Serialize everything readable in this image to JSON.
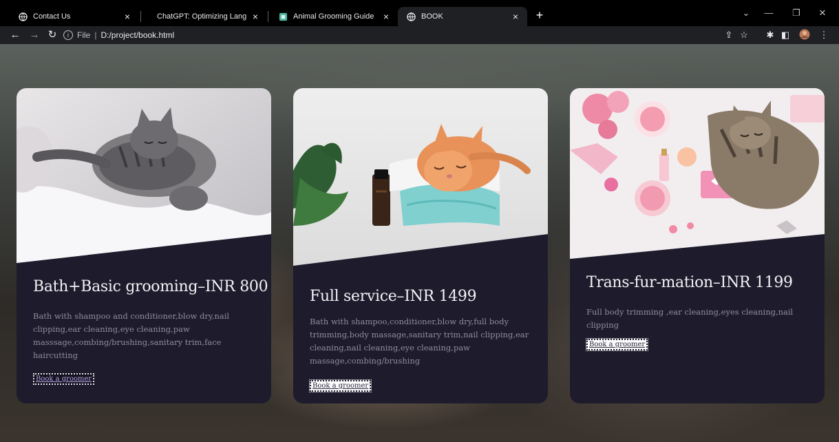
{
  "browser": {
    "tabs": [
      {
        "title": "Contact Us",
        "icon": "globe-icon",
        "active": false
      },
      {
        "title": "ChatGPT: Optimizing Language M",
        "icon": "chatgpt-icon",
        "active": false
      },
      {
        "title": "Animal Grooming Guide",
        "icon": "page-icon",
        "active": false
      },
      {
        "title": "BOOK",
        "icon": "globe-icon",
        "active": true
      }
    ],
    "address": {
      "scheme": "File",
      "url": "D:/project/book.html"
    }
  },
  "cards": [
    {
      "title": "Bath+Basic grooming–INR 800",
      "description": "Bath with shampoo and conditioner,blow dry,nail clipping,ear cleaning,eye cleaning,paw masssage,combing/brushing,sanitary trim,face haircutting",
      "button": "Book a groomer",
      "image": "sleeping tabby kitten under white blanket"
    },
    {
      "title": "Full service–INR 1499",
      "description": "Bath with shampoo,conditioner,blow dry,full body trimming,body massage,sanitary trim,nail clipping,ear cleaning,nail cleaning,eye cleaning,paw massage,combing/brushing",
      "button": "Book a groomer",
      "image": "orange kitten sleeping on teal towel beside oil bottle"
    },
    {
      "title": "Trans-fur-mation–INR 1199",
      "description": "Full body trimming ,ear cleaning,eyes cleaning,nail clipping",
      "button": "Book a groomer",
      "image": "cat relaxing among pink flowers and spa items"
    }
  ],
  "colors": {
    "card_bg": "#1e1c2c",
    "title": "#f2f2f5",
    "body_text": "#8f8c9e",
    "link": "#b9a6ef"
  }
}
